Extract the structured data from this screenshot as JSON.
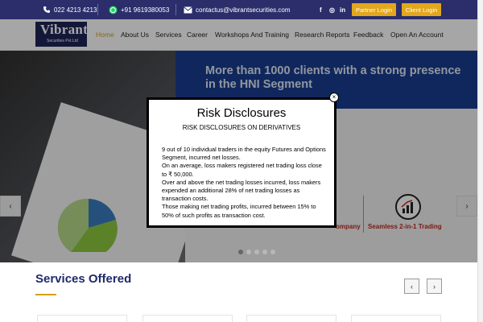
{
  "topbar": {
    "phone": "022 4213 4213",
    "whatsapp": "+91 9619380053",
    "email": "contactus@vibrantsecurities.com",
    "social": [
      "f",
      "◎",
      "in"
    ],
    "partner_login": "Partner Login",
    "client_login": "Client Login"
  },
  "logo": {
    "name": "Vibrant",
    "tagline": "Securities Pvt.Ltd"
  },
  "nav": {
    "items": [
      "Home",
      "About Us",
      "Services",
      "Career",
      "Workshops And Training",
      "Research Reports",
      "Feedback",
      "Open An Account"
    ]
  },
  "hero": {
    "headline": "More than 1000 clients with a strong presence in the HNI Segment",
    "feature_partial": "ompany",
    "feature": "Seamless 2-in-1 Trading",
    "prev": "‹",
    "next": "›"
  },
  "modal": {
    "title": "Risk Disclosures",
    "subtitle": "RISK DISCLOSURES ON DERIVATIVES",
    "paragraphs": [
      "9 out of 10 individual traders in the equity Futures and Options Segment, incurred net losses.",
      "On an average, loss makers registered net trading loss close to ₹ 50,000.",
      "Over and above the net trading losses incurred, loss makers expended an additional 28% of net trading losses as transaction costs.",
      "Those making net trading profits, incurred between 15% to 50% of such profits as transaction cost."
    ],
    "close": "×"
  },
  "services": {
    "title": "Services Offered",
    "prev": "‹",
    "next": "›"
  },
  "colors": {
    "topbar": "#2b2e6b",
    "accent": "#d4a017",
    "banner": "#1a3d8f",
    "feature_red": "#c0281c",
    "services_title": "#1f2a6b"
  }
}
